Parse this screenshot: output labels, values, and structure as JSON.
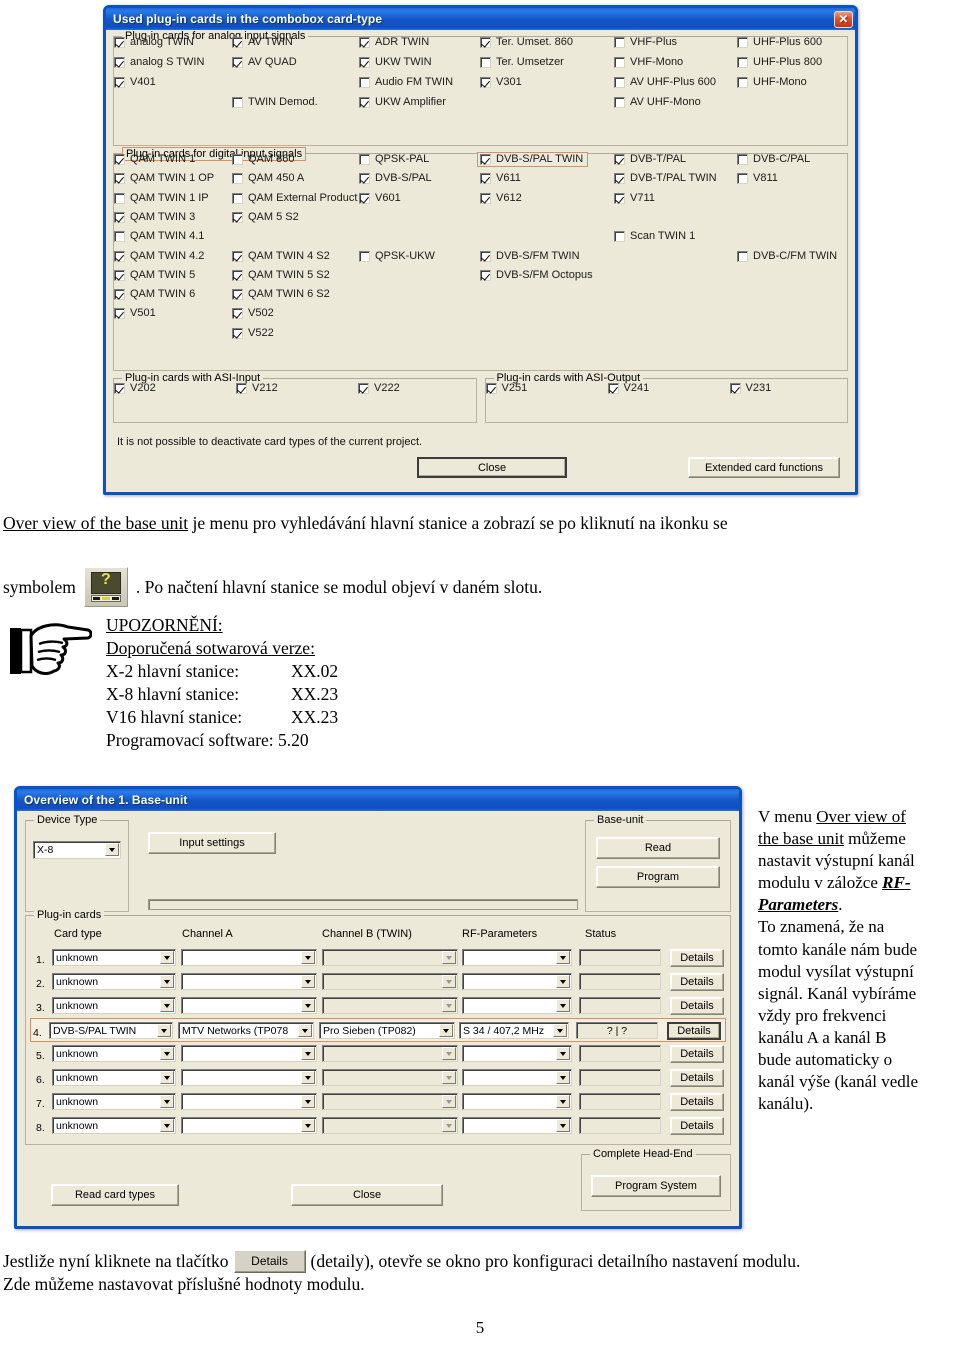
{
  "dialog1": {
    "title": "Used plug-in cards in the combobox card-type",
    "close_icon": "close-icon",
    "analog_group": {
      "legend": "Plug-in cards for analog input signals",
      "items": [
        {
          "label": "analog TWIN",
          "checked": true,
          "col": 0,
          "row": 0
        },
        {
          "label": "analog S TWIN",
          "checked": true,
          "col": 0,
          "row": 1
        },
        {
          "label": "V401",
          "checked": true,
          "col": 0,
          "row": 2
        },
        {
          "label": "AV TWIN",
          "checked": true,
          "col": 1,
          "row": 0
        },
        {
          "label": "AV QUAD",
          "checked": true,
          "col": 1,
          "row": 1
        },
        {
          "label": "TWIN Demod.",
          "checked": false,
          "col": 1,
          "row": 3
        },
        {
          "label": "ADR TWIN",
          "checked": true,
          "col": 2,
          "row": 0
        },
        {
          "label": "UKW TWIN",
          "checked": true,
          "col": 2,
          "row": 1
        },
        {
          "label": "Audio FM TWIN",
          "checked": false,
          "col": 2,
          "row": 2
        },
        {
          "label": "UKW Amplifier",
          "checked": true,
          "col": 2,
          "row": 3
        },
        {
          "label": "Ter. Umset. 860",
          "checked": true,
          "col": 3,
          "row": 0
        },
        {
          "label": "Ter. Umsetzer",
          "checked": false,
          "col": 3,
          "row": 1
        },
        {
          "label": "V301",
          "checked": true,
          "col": 3,
          "row": 2
        },
        {
          "label": "VHF-Plus",
          "checked": false,
          "col": 4,
          "row": 0
        },
        {
          "label": "VHF-Mono",
          "checked": false,
          "col": 4,
          "row": 1
        },
        {
          "label": "AV UHF-Plus 600",
          "checked": false,
          "col": 4,
          "row": 2
        },
        {
          "label": "AV UHF-Mono",
          "checked": false,
          "col": 4,
          "row": 3
        },
        {
          "label": "UHF-Plus 600",
          "checked": false,
          "col": 5,
          "row": 0
        },
        {
          "label": "UHF-Plus 800",
          "checked": false,
          "col": 5,
          "row": 1
        },
        {
          "label": "UHF-Mono",
          "checked": false,
          "col": 5,
          "row": 2
        }
      ]
    },
    "digital_group": {
      "legend": "Plug-in cards for digital input signals",
      "items": [
        {
          "label": "QAM TWIN 1",
          "checked": true,
          "col": 0,
          "row": 0
        },
        {
          "label": "QAM TWIN 1 OP",
          "checked": true,
          "col": 0,
          "row": 1
        },
        {
          "label": "QAM TWIN 1 IP",
          "checked": false,
          "col": 0,
          "row": 2
        },
        {
          "label": "QAM TWIN 3",
          "checked": true,
          "col": 0,
          "row": 3
        },
        {
          "label": "QAM TWIN 4.1",
          "checked": false,
          "col": 0,
          "row": 4
        },
        {
          "label": "QAM TWIN 4.2",
          "checked": true,
          "col": 0,
          "row": 5
        },
        {
          "label": "QAM TWIN 5",
          "checked": true,
          "col": 0,
          "row": 6
        },
        {
          "label": "QAM TWIN 6",
          "checked": true,
          "col": 0,
          "row": 7
        },
        {
          "label": "V501",
          "checked": true,
          "col": 0,
          "row": 8
        },
        {
          "label": "QAM 860",
          "checked": false,
          "col": 1,
          "row": 0
        },
        {
          "label": "QAM 450 A",
          "checked": false,
          "col": 1,
          "row": 1
        },
        {
          "label": "QAM External Product",
          "checked": false,
          "col": 1,
          "row": 2
        },
        {
          "label": "QAM 5 S2",
          "checked": true,
          "col": 1,
          "row": 3
        },
        {
          "label": "QAM TWIN 4 S2",
          "checked": true,
          "col": 1,
          "row": 5
        },
        {
          "label": "QAM TWIN 5 S2",
          "checked": true,
          "col": 1,
          "row": 6
        },
        {
          "label": "QAM TWIN 6 S2",
          "checked": true,
          "col": 1,
          "row": 7
        },
        {
          "label": "V502",
          "checked": true,
          "col": 1,
          "row": 8
        },
        {
          "label": "V522",
          "checked": true,
          "col": 1,
          "row": 9
        },
        {
          "label": "QPSK-PAL",
          "checked": false,
          "col": 2,
          "row": 0
        },
        {
          "label": "DVB-S/PAL",
          "checked": true,
          "col": 2,
          "row": 1
        },
        {
          "label": "V601",
          "checked": true,
          "col": 2,
          "row": 2
        },
        {
          "label": "QPSK-UKW",
          "checked": false,
          "col": 2,
          "row": 5
        },
        {
          "label": "DVB-S/PAL TWIN",
          "checked": true,
          "col": 3,
          "row": 0,
          "highlight": true
        },
        {
          "label": "V611",
          "checked": true,
          "col": 3,
          "row": 1
        },
        {
          "label": "V612",
          "checked": true,
          "col": 3,
          "row": 2
        },
        {
          "label": "DVB-S/FM TWIN",
          "checked": true,
          "col": 3,
          "row": 5
        },
        {
          "label": "DVB-S/FM Octopus",
          "checked": true,
          "col": 3,
          "row": 6
        },
        {
          "label": "DVB-T/PAL",
          "checked": true,
          "col": 4,
          "row": 0
        },
        {
          "label": "DVB-T/PAL TWIN",
          "checked": true,
          "col": 4,
          "row": 1
        },
        {
          "label": "V711",
          "checked": true,
          "col": 4,
          "row": 2
        },
        {
          "label": "Scan TWIN 1",
          "checked": false,
          "col": 4,
          "row": 4
        },
        {
          "label": "DVB-C/PAL",
          "checked": false,
          "col": 5,
          "row": 0
        },
        {
          "label": "V811",
          "checked": false,
          "col": 5,
          "row": 1
        },
        {
          "label": "DVB-C/FM TWIN",
          "checked": false,
          "col": 5,
          "row": 5
        }
      ]
    },
    "asi_input_group": {
      "legend": "Plug-in cards with ASI-Input",
      "items": [
        {
          "label": "V202",
          "checked": true
        },
        {
          "label": "V212",
          "checked": true
        },
        {
          "label": "V222",
          "checked": true
        }
      ]
    },
    "asi_output_group": {
      "legend": "Plug-in cards with ASI-Output",
      "items": [
        {
          "label": "V251",
          "checked": true
        },
        {
          "label": "V241",
          "checked": true
        },
        {
          "label": "V231",
          "checked": true
        }
      ]
    },
    "note": "It is not possible to deactivate card types of the current project.",
    "close_button": "Close",
    "extended_button": "Extended card functions"
  },
  "para1": {
    "link": "Over view of the base unit",
    "rest": " je menu pro vyhledávání hlavní stanice a zobrazí se po kliknutí na ikonku se",
    "line2_pre": "symbolem",
    "line2_post": ". Po načtení hlavní stanice se modul objeví v daném slotu."
  },
  "notice": {
    "icon": "pointing-hand-icon",
    "heading": "UPOZORNĚNÍ:",
    "subheading": "Doporučená sotwarová verze:",
    "rows": [
      {
        "label": "X-2 hlavní stanice:",
        "value": "XX.02"
      },
      {
        "label": "X-8 hlavní stanice:",
        "value": "XX.23"
      },
      {
        "label": "V16 hlavní stanice:",
        "value": "XX.23"
      }
    ],
    "software_label": "Programovací software:",
    "software_value": "5.20"
  },
  "dialog2": {
    "title": "Overview of the 1. Base-unit",
    "device_type_legend": "Device Type",
    "device_type_value": "X-8",
    "input_settings_button": "Input settings",
    "baseunit_legend": "Base-unit",
    "read_button": "Read",
    "program_button": "Program",
    "plugin_legend": "Plug-in cards",
    "columns": [
      "Card type",
      "Channel A",
      "Channel B (TWIN)",
      "RF-Parameters",
      "Status"
    ],
    "details_label": "Details",
    "rows": [
      {
        "n": "1.",
        "card": "unknown",
        "a": "",
        "b": "",
        "rf": "",
        "status": "",
        "highlight": false
      },
      {
        "n": "2.",
        "card": "unknown",
        "a": "",
        "b": "",
        "rf": "",
        "status": "",
        "highlight": false
      },
      {
        "n": "3.",
        "card": "unknown",
        "a": "",
        "b": "",
        "rf": "",
        "status": "",
        "highlight": false
      },
      {
        "n": "4.",
        "card": "DVB-S/PAL TWIN",
        "a": "MTV Networks (TP078",
        "b": "Pro Sieben (TP082)",
        "rf": "S 34 / 407,2 MHz",
        "status": "?  |  ?",
        "highlight": true
      },
      {
        "n": "5.",
        "card": "unknown",
        "a": "",
        "b": "",
        "rf": "",
        "status": "",
        "highlight": false
      },
      {
        "n": "6.",
        "card": "unknown",
        "a": "",
        "b": "",
        "rf": "",
        "status": "",
        "highlight": false
      },
      {
        "n": "7.",
        "card": "unknown",
        "a": "",
        "b": "",
        "rf": "",
        "status": "",
        "highlight": false
      },
      {
        "n": "8.",
        "card": "unknown",
        "a": "",
        "b": "",
        "rf": "",
        "status": "",
        "highlight": false
      }
    ],
    "read_card_types_button": "Read card types",
    "close_button": "Close",
    "complete_headend_legend": "Complete Head-End",
    "program_system_button": "Program System"
  },
  "sidetext": {
    "l1_pre": "V menu ",
    "l1_link": "Over view of",
    "l2_link": "the base unit",
    "l2_post": " můžeme",
    "l3": "nastavit výstupní kanál",
    "l4_pre": "modulu v záložce ",
    "l4_bold": "RF-",
    "l5_bold": "Parameters",
    "l5_post": ".",
    "l6": "To znamená, že na",
    "l7": "tomto kanále nám bude",
    "l8": "modul vysílat výstupní",
    "l9": "signál. Kanál vybíráme",
    "l10": "vždy pro frekvenci",
    "l11": "kanálu A a kanál B",
    "l12": "bude automaticky o",
    "l13": "kanál výše (kanál vedle",
    "l14": "kanálu)."
  },
  "para2": {
    "pre": "Jestliže nyní kliknete na tlačítko",
    "btn": "Details",
    "post": " (detaily), otevře se okno pro konfiguraci detailního nastavení modulu.",
    "line2": "Zde můžeme nastavovat příslušné hodnoty modulu."
  },
  "page_number": "5"
}
